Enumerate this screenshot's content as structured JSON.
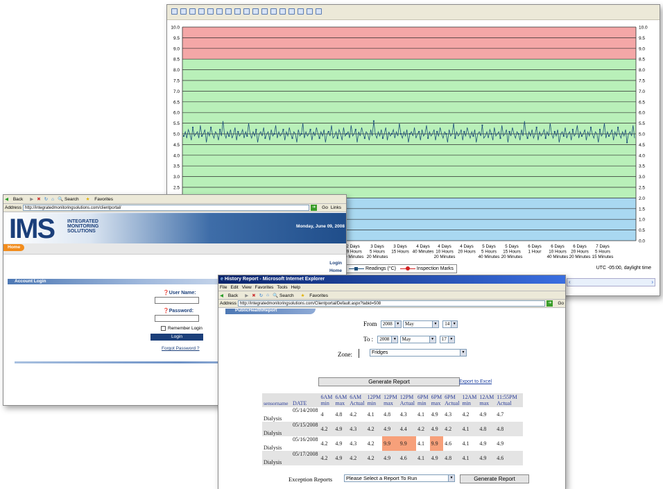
{
  "chart_window": {
    "toolbar_icons": [
      "new-icon",
      "open-icon",
      "save-icon",
      "print-icon",
      "copy-icon",
      "properties-icon",
      "legend-icon",
      "data-icon",
      "zoom-icon",
      "zoom-fit-icon",
      "gallery-icon",
      "gallery2-icon",
      "chart-icon",
      "chart2-icon",
      "tools-icon",
      "help-icon",
      "whats-this-icon"
    ],
    "legend_readings": "Readings (°C)",
    "legend_inspection": "Inspection Marks",
    "timezone": "UTC -05:00, daylight time"
  },
  "chart_data": {
    "type": "line",
    "ylim": [
      0,
      10
    ],
    "yticks": [
      "10.0",
      "9.5",
      "9.0",
      "8.5",
      "8.0",
      "7.5",
      "7.0",
      "6.5",
      "6.0",
      "5.5",
      "5.0",
      "4.5",
      "4.0",
      "3.5",
      "3.0",
      "2.5",
      "2.0",
      "1.5",
      "1.0",
      "0.5",
      "0.0"
    ],
    "bands": [
      {
        "from": 8.5,
        "to": 10,
        "color": "#f4a7a7"
      },
      {
        "from": 2.0,
        "to": 8.5,
        "color": "#b9f0b9"
      },
      {
        "from": 0,
        "to": 2.0,
        "color": "#a9d8f1"
      }
    ],
    "series_color": "#1e4f7a",
    "baseline_value": 5.0,
    "xtick_labels": [
      [
        "2 Days",
        "19 Hours",
        "40 Minutes"
      ],
      [
        "3 Days",
        "5 Hours",
        "20 Minutes"
      ],
      [
        "3 Days",
        "15 Hours",
        ""
      ],
      [
        "4 Days",
        "40 Minutes",
        ""
      ],
      [
        "4 Days",
        "10 Hours",
        "20 Minutes"
      ],
      [
        "4 Days",
        "20 Hours",
        ""
      ],
      [
        "5 Days",
        "5 Hours",
        "40 Minutes"
      ],
      [
        "5 Days",
        "15 Hours",
        "20 Minutes"
      ],
      [
        "6 Days",
        "1 Hour",
        ""
      ],
      [
        "6 Days",
        "10 Hours",
        "40 Minutes"
      ],
      [
        "6 Days",
        "20 Hours",
        "20 Minutes"
      ],
      [
        "7 Days",
        "5 Hours",
        "15 Minutes"
      ]
    ],
    "series": [
      {
        "name": "Readings (°C)",
        "values": [
          4.9,
          5.1,
          4.8,
          5.2,
          5.0,
          4.7,
          5.3,
          4.9,
          5.0,
          5.1,
          4.8,
          5.4,
          4.9,
          5.0,
          5.2,
          4.6,
          5.1,
          4.9,
          5.3,
          5.0,
          4.8,
          5.1,
          5.0,
          4.7,
          5.2,
          4.9,
          5.6,
          5.0,
          4.8,
          5.1,
          4.9,
          5.2,
          4.8,
          5.0,
          5.3,
          4.7,
          5.1,
          4.9,
          5.0,
          5.2,
          4.8,
          5.1,
          4.9,
          5.5,
          5.0,
          4.8,
          5.1,
          4.9,
          5.2,
          4.6,
          5.0,
          5.1,
          4.9,
          5.3,
          4.8,
          5.0,
          5.1,
          4.7,
          5.2,
          4.9,
          5.0,
          5.4,
          4.8,
          5.1,
          4.9,
          5.0,
          5.2,
          4.7,
          5.1,
          4.9,
          5.3,
          5.0,
          4.8,
          5.1,
          5.0,
          4.6,
          5.2,
          4.9,
          5.0,
          5.5,
          4.8,
          5.1,
          4.9,
          5.0,
          5.2,
          4.7,
          5.1,
          4.9,
          5.3,
          5.0,
          4.8,
          5.1,
          4.9,
          5.2,
          4.6,
          5.0,
          5.1,
          4.9,
          5.4,
          4.8
        ]
      }
    ]
  },
  "login_window": {
    "toolbar": {
      "back": "Back",
      "search": "Search",
      "favorites": "Favorites"
    },
    "address_label": "Address",
    "address": "http://integratedmonitoringsolutions.com/clientportal/",
    "go": "Go",
    "links": "Links",
    "logo_text": "IMS",
    "logo_sub": [
      "INTEGRATED",
      "MONITORING",
      "SOLUTIONS"
    ],
    "date": "Monday, June 09, 2008",
    "home_tab": "Home",
    "right_links": [
      "Login",
      "Home"
    ],
    "account_login": "Account Login",
    "username_label": "User Name:",
    "password_label": "Password:",
    "remember": "Remember Login",
    "login_button": "Login",
    "forgot": "Forgot Password ?"
  },
  "report_window": {
    "title": "History Report - Microsoft Internet Explorer",
    "menu": [
      "File",
      "Edit",
      "View",
      "Favorites",
      "Tools",
      "Help"
    ],
    "toolbar": {
      "back": "Back",
      "search": "Search",
      "favorites": "Favorites"
    },
    "address_label": "Address",
    "address": "http://integratedmonitoringsolutions.com/Clientportal/Default.aspx?tabid=508",
    "go": "Go",
    "tab": "PublicHealthReport",
    "from_label": "From",
    "to_label": "To :",
    "from": {
      "year": "2008",
      "month": "May",
      "day": "14"
    },
    "to": {
      "year": "2008",
      "month": "May",
      "day": "17"
    },
    "zone_label": "Zone:",
    "zone": "Fridges",
    "generate": "Generate Report",
    "export": "Export to Excel",
    "columns": [
      "sensorname",
      "DATE",
      "6AM min",
      "6AM max",
      "6AM Actual",
      "12PM min",
      "12PM max",
      "12PM Actual",
      "6PM min",
      "6PM max",
      "6PM Actual",
      "12AM min",
      "12AM max",
      "11:55PM Actual"
    ],
    "rows": [
      [
        "Dialysis",
        "05/14/2008",
        "4",
        "4.8",
        "4.2",
        "4.1",
        "4.8",
        "4.3",
        "4.1",
        "4.9",
        "4.3",
        "4.2",
        "4.9",
        "4.7"
      ],
      [
        "Dialysis",
        "05/15/2008",
        "4.2",
        "4.9",
        "4.3",
        "4.2",
        "4.9",
        "4.4",
        "4.2",
        "4.9",
        "4.2",
        "4.1",
        "4.8",
        "4.8"
      ],
      [
        "Dialysis",
        "05/16/2008",
        "4.2",
        "4.9",
        "4.3",
        "4.2",
        "9.9",
        "9.9",
        "4.1",
        "9.9",
        "4.6",
        "4.1",
        "4.9",
        "4.9"
      ],
      [
        "Dialysis",
        "05/17/2008",
        "4.2",
        "4.9",
        "4.2",
        "4.2",
        "4.9",
        "4.6",
        "4.1",
        "4.9",
        "4.8",
        "4.1",
        "4.9",
        "4.6"
      ]
    ],
    "highlight_cells": [
      [
        2,
        6
      ],
      [
        2,
        7
      ],
      [
        2,
        9
      ]
    ],
    "highlight_color": "#f7a07a",
    "exception_label": "Exception Reports",
    "exception_select": "Please Select a Report To Run",
    "generate2": "Generate Report"
  }
}
